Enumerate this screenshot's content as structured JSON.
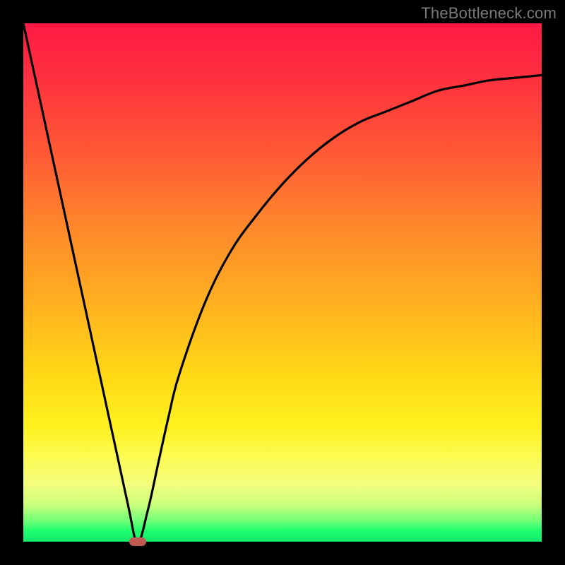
{
  "watermark": "TheBottleneck.com",
  "colors": {
    "page_bg": "#000000",
    "curve": "#000000",
    "min_marker": "#c15a52",
    "gradient_top": "#ff1a44",
    "gradient_bottom": "#16e66a"
  },
  "chart_data": {
    "type": "line",
    "title": "",
    "xlabel": "",
    "ylabel": "",
    "xlim": [
      0,
      100
    ],
    "ylim": [
      0,
      100
    ],
    "grid": false,
    "legend": false,
    "series": [
      {
        "name": "bottleneck-curve",
        "x": [
          0,
          5,
          10,
          15,
          20,
          22,
          24,
          26,
          28,
          30,
          35,
          40,
          45,
          50,
          55,
          60,
          65,
          70,
          75,
          80,
          85,
          90,
          95,
          100
        ],
        "y": [
          100,
          77,
          54,
          31,
          8,
          0,
          6,
          15,
          24,
          32,
          46,
          56,
          63,
          69,
          74,
          78,
          81,
          83,
          85,
          87,
          88,
          89,
          89.5,
          90
        ]
      }
    ],
    "annotations": [
      {
        "name": "minimum-marker",
        "x": 22,
        "y": 0
      }
    ]
  }
}
